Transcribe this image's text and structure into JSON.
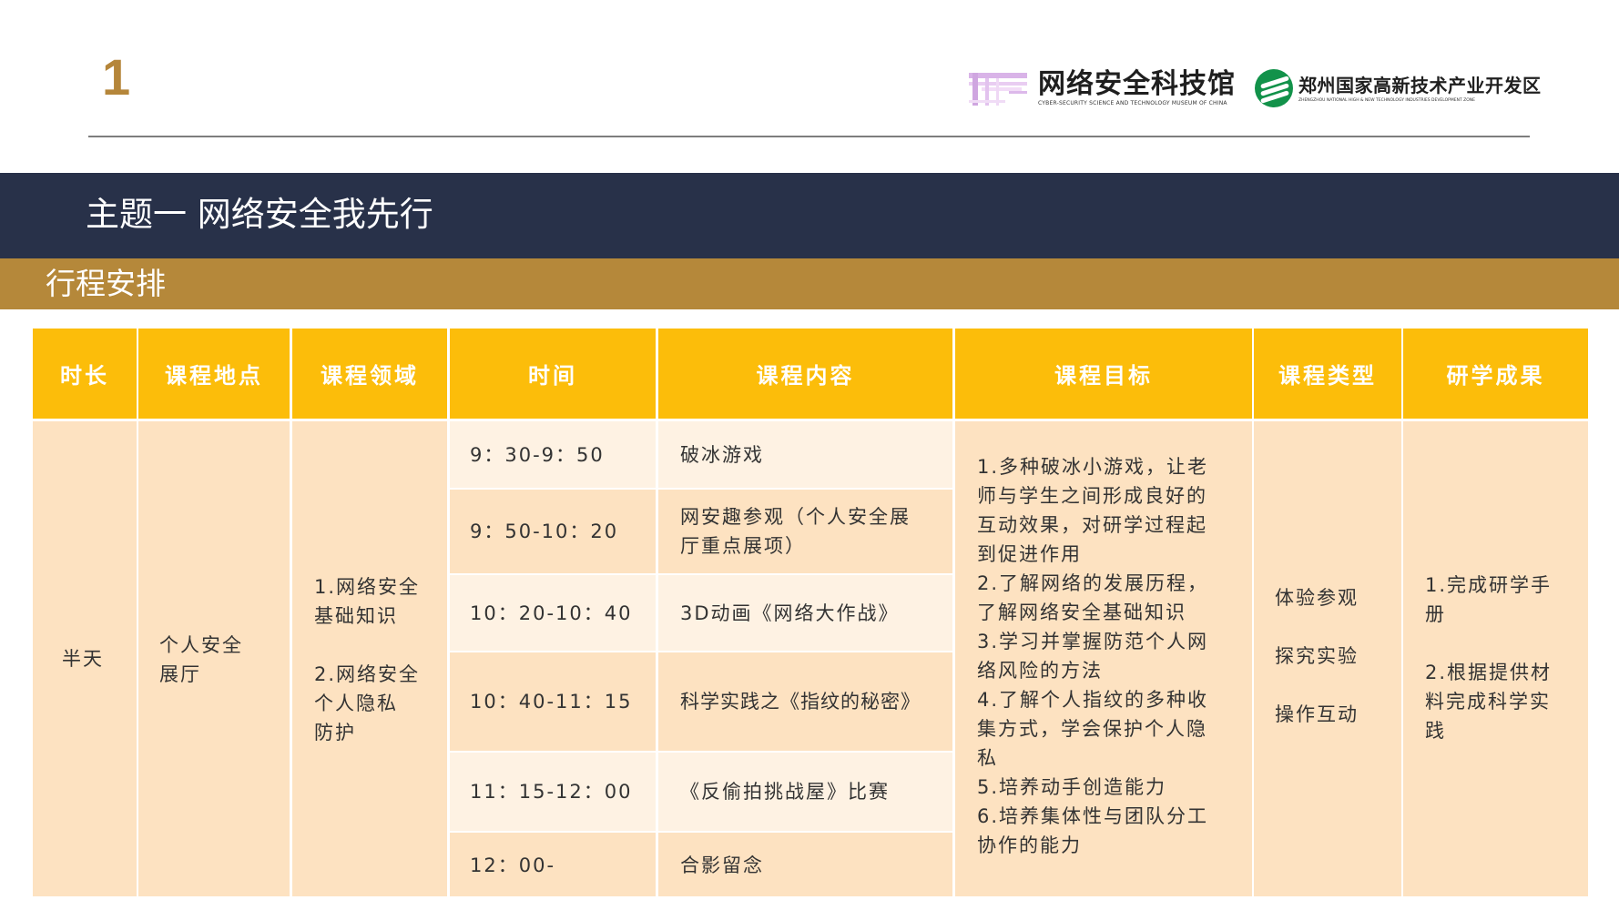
{
  "page": {
    "number": "1"
  },
  "logos": {
    "museum": {
      "cn": "网络安全科技馆",
      "en": "CYBER-SECURITY SCIENCE AND TECHNOLOGY MUSEUM OF CHINA"
    },
    "zone": {
      "cn": "郑州国家高新技术产业开发区",
      "en": "ZHENGZHOU NATIONAL HIGH & NEW TECHNOLOGY INDUSTRIES DEVELOPMENT ZONE"
    }
  },
  "theme_title": "主题一 网络安全我先行",
  "section_title": "行程安排",
  "table": {
    "headers": [
      "时长",
      "课程地点",
      "课程领域",
      "时间",
      "课程内容",
      "课程目标",
      "课程类型",
      "研学成果"
    ],
    "duration": "半天",
    "location": "个人安全\n展厅",
    "domain": "1.网络安全\n基础知识\n\n2.网络安全\n个人隐私\n防护",
    "rows": [
      {
        "time": "9：30-9：50",
        "content": "破冰游戏"
      },
      {
        "time": "9：50-10：20",
        "content": "网安趣参观（个人安全展\n厅重点展项）"
      },
      {
        "time": "10：20-10：40",
        "content": "3D动画《网络大作战》"
      },
      {
        "time": "10：40-11：15",
        "content": "科学实践之《指纹的秘密》"
      },
      {
        "time": "11：15-12：00",
        "content": "《反偷拍挑战屋》比赛"
      },
      {
        "time": "12：00-",
        "content": "合影留念"
      }
    ],
    "objectives": "1.多种破冰小游戏，让老\n师与学生之间形成良好的\n互动效果，对研学过程起\n到促进作用\n2.了解网络的发展历程，\n了解网络安全基础知识\n3.学习并掌握防范个人网\n络风险的方法\n4.了解个人指纹的多种收\n集方式，学会保护个人隐\n私\n5.培养动手创造能力\n6.培养集体性与团队分工\n协作的能力",
    "course_types": "体验参观\n\n探究实验\n\n操作互动",
    "outcomes": "1.完成研学手\n册\n\n2.根据提供材\n料完成科学实\n践"
  },
  "colors": {
    "header_yellow": "#fcbd0a",
    "theme_navy": "#283149",
    "section_gold": "#b5883a",
    "cell_peach": "#fde2c1",
    "cell_light": "#fef2e3",
    "page_number": "#b5863a"
  }
}
